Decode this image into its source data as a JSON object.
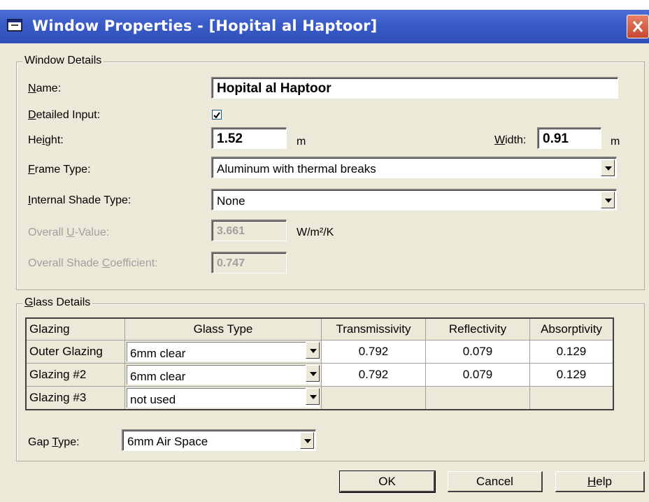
{
  "window": {
    "title": "Window Properties - [Hopital al Haptoor]"
  },
  "window_details": {
    "legend": "Window Details",
    "name_label": "Name:",
    "name_value": "Hopital al Haptoor",
    "detailed_input_label": "Detailed Input:",
    "detailed_input_checked": true,
    "height_label": "Height:",
    "height_value": "1.52",
    "height_unit": "m",
    "width_label": "Width:",
    "width_value": "0.91",
    "width_unit": "m",
    "frame_type_label": "Frame Type:",
    "frame_type_value": "Aluminum with thermal breaks",
    "shade_type_label": "Internal Shade Type:",
    "shade_type_value": "None",
    "u_value_label": "Overall U-Value:",
    "u_value": "3.661",
    "u_value_unit": "W/m²/K",
    "shade_coeff_label": "Overall Shade Coefficient:",
    "shade_coeff_value": "0.747"
  },
  "glass_details": {
    "legend": "Glass Details",
    "columns": [
      "Glazing",
      "Glass Type",
      "Transmissivity",
      "Reflectivity",
      "Absorptivity"
    ],
    "rows": [
      {
        "glazing": "Outer Glazing",
        "glass_type": "6mm clear",
        "transmissivity": "0.792",
        "reflectivity": "0.079",
        "absorptivity": "0.129"
      },
      {
        "glazing": "Glazing #2",
        "glass_type": "6mm clear",
        "transmissivity": "0.792",
        "reflectivity": "0.079",
        "absorptivity": "0.129"
      },
      {
        "glazing": "Glazing #3",
        "glass_type": "not used",
        "transmissivity": "",
        "reflectivity": "",
        "absorptivity": ""
      }
    ],
    "gap_type_label": "Gap Type:",
    "gap_type_value": "6mm Air Space"
  },
  "buttons": {
    "ok": "OK",
    "cancel": "Cancel",
    "help": "Help"
  },
  "colors": {
    "titlebar": "#3a5cc8",
    "dialog_bg": "#ece9d8",
    "close_button": "#d0583c"
  },
  "icons": {
    "title_icon": "window-app-icon",
    "close": "close-icon",
    "dropdown": "chevron-down-icon",
    "check": "checkmark-icon"
  }
}
